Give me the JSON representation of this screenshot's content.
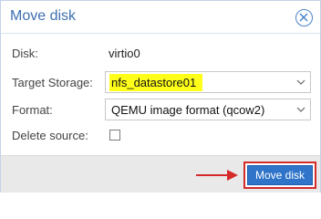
{
  "dialog": {
    "title": "Move disk",
    "close_icon": "close-circle-icon"
  },
  "form": {
    "disk_label": "Disk:",
    "disk_value": "virtio0",
    "target_storage_label": "Target Storage:",
    "target_storage_value": "nfs_datastore01",
    "format_label": "Format:",
    "format_value": "QEMU image format (qcow2)",
    "delete_source_label": "Delete source:",
    "delete_source_checked": false
  },
  "footer": {
    "move_button_label": "Move disk",
    "annotation_color": "#d42a2a",
    "highlight_color": "#ffff1a"
  }
}
